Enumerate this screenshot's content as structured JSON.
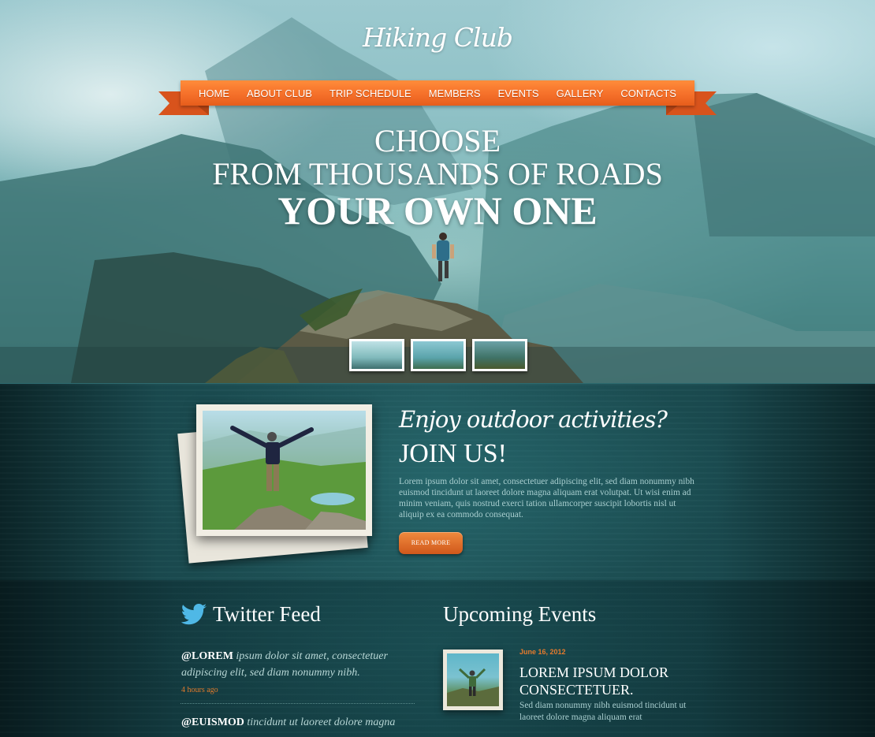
{
  "site": {
    "logo": "Hiking Club"
  },
  "nav": {
    "items": [
      {
        "label": "HOME"
      },
      {
        "label": "ABOUT CLUB"
      },
      {
        "label": "TRIP SCHEDULE"
      },
      {
        "label": "MEMBERS"
      },
      {
        "label": "EVENTS"
      },
      {
        "label": "GALLERY"
      },
      {
        "label": "CONTACTS"
      }
    ]
  },
  "hero": {
    "line1": "CHOOSE",
    "line2": "FROM THOUSANDS OF ROADS",
    "line3": "YOUR OWN ONE"
  },
  "join": {
    "tagline": "Enjoy outdoor activities?",
    "title": "JOIN US!",
    "text": "Lorem ipsum dolor sit amet, consectetuer adipiscing elit, sed diam nonummy nibh euismod tincidunt ut laoreet dolore magna aliquam erat volutpat. Ut wisi enim ad minim veniam, quis nostrud exerci tation ullamcorper suscipit lobortis nisl ut aliquip ex ea commodo consequat.",
    "button": "READ MORE"
  },
  "twitter": {
    "heading": "Twitter Feed",
    "tweets": [
      {
        "handle": "@LOREM",
        "text": "ipsum dolor sit amet, consectetuer adipiscing elit, sed diam nonummy nibh.",
        "time": "4 hours ago"
      },
      {
        "handle": "@EUISMOD",
        "text": "tincidunt ut laoreet dolore magna"
      }
    ]
  },
  "events": {
    "heading": "Upcoming Events",
    "items": [
      {
        "date": "June 16, 2012",
        "title": "LOREM IPSUM DOLOR CONSECTETUER.",
        "text": "Sed diam nonummy nibh euismod tincidunt ut laoreet dolore magna aliquam erat"
      }
    ]
  },
  "colors": {
    "accent": "#f5702a",
    "date_orange": "#e47a2d",
    "dark_teal": "#17474c"
  }
}
